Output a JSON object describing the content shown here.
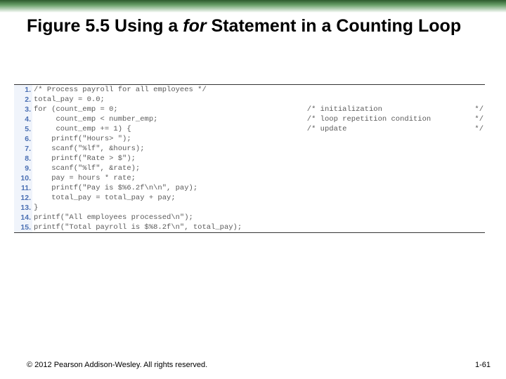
{
  "title": {
    "pre": "Figure 5.5  Using a ",
    "ital": "for",
    "post": " Statement in a Counting Loop"
  },
  "code": {
    "lines": [
      {
        "n": "1.",
        "c": "/* Process payroll for all employees */",
        "cm": "",
        "ce": ""
      },
      {
        "n": "2.",
        "c": "total_pay = 0.0;",
        "cm": "",
        "ce": ""
      },
      {
        "n": "3.",
        "c": "for (count_emp = 0;",
        "cm": "/* initialization",
        "ce": "*/"
      },
      {
        "n": "4.",
        "c": "     count_emp < number_emp;",
        "cm": "/* loop repetition condition",
        "ce": "*/"
      },
      {
        "n": "5.",
        "c": "     count_emp += 1) {",
        "cm": "/* update",
        "ce": "*/"
      },
      {
        "n": "6.",
        "c": "    printf(\"Hours> \");",
        "cm": "",
        "ce": ""
      },
      {
        "n": "7.",
        "c": "    scanf(\"%lf\", &hours);",
        "cm": "",
        "ce": ""
      },
      {
        "n": "8.",
        "c": "    printf(\"Rate > $\");",
        "cm": "",
        "ce": ""
      },
      {
        "n": "9.",
        "c": "    scanf(\"%lf\", &rate);",
        "cm": "",
        "ce": ""
      },
      {
        "n": "10.",
        "c": "    pay = hours * rate;",
        "cm": "",
        "ce": ""
      },
      {
        "n": "11.",
        "c": "    printf(\"Pay is $%6.2f\\n\\n\", pay);",
        "cm": "",
        "ce": ""
      },
      {
        "n": "12.",
        "c": "    total_pay = total_pay + pay;",
        "cm": "",
        "ce": ""
      },
      {
        "n": "13.",
        "c": "}",
        "cm": "",
        "ce": ""
      },
      {
        "n": "14.",
        "c": "printf(\"All employees processed\\n\");",
        "cm": "",
        "ce": ""
      },
      {
        "n": "15.",
        "c": "printf(\"Total payroll is $%8.2f\\n\", total_pay);",
        "cm": "",
        "ce": ""
      }
    ]
  },
  "footer": "© 2012 Pearson Addison-Wesley. All rights reserved.",
  "pagenum": "1-61"
}
